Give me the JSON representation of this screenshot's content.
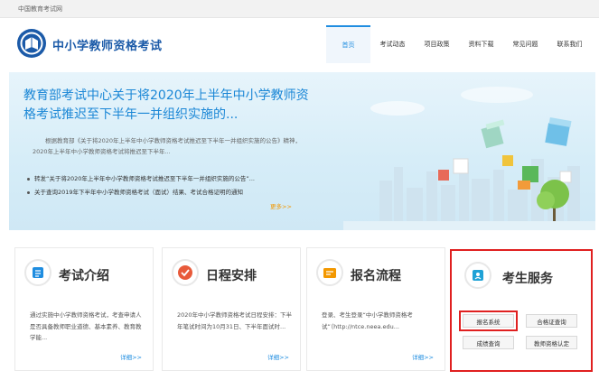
{
  "topbar": {
    "text": "中国教育考试网"
  },
  "header": {
    "site_title": "中小学教师资格考试",
    "nav": [
      {
        "label": "首页",
        "active": true
      },
      {
        "label": "考试动态"
      },
      {
        "label": "项目政策"
      },
      {
        "label": "资料下载"
      },
      {
        "label": "常见问题"
      },
      {
        "label": "联系我们"
      }
    ]
  },
  "banner": {
    "title": "教育部考试中心关于将2020年上半年中小学教师资格考试推迟至下半年一并组织实施的...",
    "summary": "根据教育部《关于将2020年上半年中小学教师资格考试推迟至下半年一并组织实施的公告》精神，2020年上半年中小学教师资格考试将推迟至下半年...",
    "links": [
      "转发“关于将2020年上半年中小学教师资格考试推迟至下半年一并组织实施的公告”...",
      "关于查询2019年下半年中小学教师资格考试（面试）结果、考试合格证明的通知"
    ],
    "more": "更多>>"
  },
  "cards": [
    {
      "title": "考试介绍",
      "body": "通过实施中小学教师资格考试，考查申请人是否具备教师职业道德、基本素养、教育教学能...",
      "more": "详细>>"
    },
    {
      "title": "日程安排",
      "body": "2020年中小学教师资格考试日程安排：下半年笔试时间为10月31日、下半年面试时...",
      "more": "详细>>"
    },
    {
      "title": "报名流程",
      "body": "登录、考生登录“中小学教师资格考试”（http://ntce.neea.edu...",
      "more": "详细>>"
    }
  ],
  "service": {
    "title": "考生服务",
    "buttons": [
      "报名系统",
      "合格证查询",
      "成绩查询",
      "教师资格认定"
    ]
  },
  "colors": {
    "accent": "#1f8de0",
    "highlight": "#e02020",
    "more": "#f39800"
  }
}
